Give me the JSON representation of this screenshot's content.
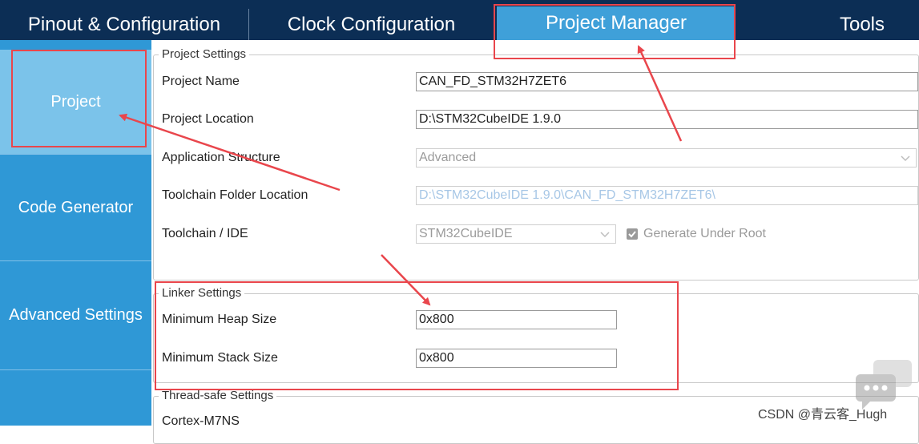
{
  "tabs": [
    {
      "label": "Pinout & Configuration",
      "active": false
    },
    {
      "label": "Clock Configuration",
      "active": false
    },
    {
      "label": "Project Manager",
      "active": true
    },
    {
      "label": "Tools",
      "active": false
    }
  ],
  "sidebar": {
    "items": [
      {
        "label": "Project",
        "active": true
      },
      {
        "label": "Code Generator",
        "active": false
      },
      {
        "label": "Advanced Settings",
        "active": false
      }
    ]
  },
  "project_settings": {
    "title": "Project Settings",
    "project_name": {
      "label": "Project Name",
      "value": "CAN_FD_STM32H7ZET6"
    },
    "project_location": {
      "label": "Project Location",
      "value": "D:\\STM32CubeIDE 1.9.0"
    },
    "application_structure": {
      "label": "Application Structure",
      "value": "Advanced"
    },
    "toolchain_folder": {
      "label": "Toolchain Folder Location",
      "value": "D:\\STM32CubeIDE 1.9.0\\CAN_FD_STM32H7ZET6\\"
    },
    "toolchain_ide": {
      "label": "Toolchain / IDE",
      "value": "STM32CubeIDE"
    },
    "generate_under_root": {
      "label": "Generate Under Root",
      "checked": true
    }
  },
  "linker_settings": {
    "title": "Linker Settings",
    "min_heap": {
      "label": "Minimum Heap Size",
      "value": "0x800"
    },
    "min_stack": {
      "label": "Minimum Stack Size",
      "value": "0x800"
    }
  },
  "thread_safe": {
    "title": "Thread-safe Settings",
    "core": "Cortex-M7NS"
  },
  "watermark": {
    "text": "CSDN @青云客_Hugh"
  },
  "colors": {
    "topbar": "#0c2e55",
    "active_tab": "#3fa0d9",
    "sidebar": "#2f98d6",
    "sidebar_active": "#7bc3ea",
    "highlight": "#e9464c"
  }
}
